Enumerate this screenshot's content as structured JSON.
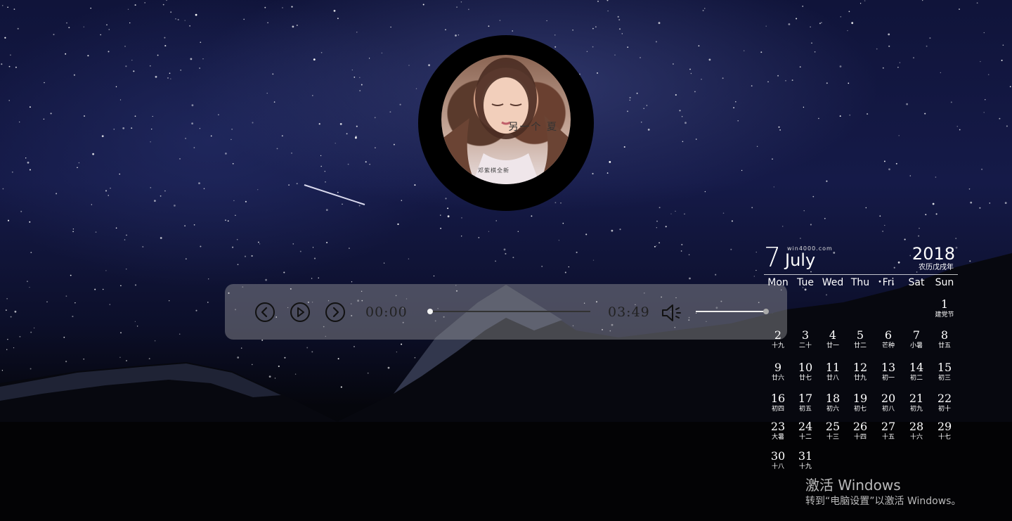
{
  "album": {
    "title_text": "另一个 夏",
    "caption_text": "邓紫棋全新"
  },
  "player": {
    "current_time": "00:00",
    "total_time": "03:49",
    "progress": 0,
    "volume": 1.0,
    "icons": {
      "prev": "chevron-left-circle-icon",
      "play": "play-circle-icon",
      "next": "chevron-right-circle-icon",
      "volume": "speaker-icon"
    }
  },
  "calendar": {
    "day": "7",
    "month": "July",
    "site": "win4000.com",
    "year": "2018",
    "lunar_year": "农历戊戌年",
    "weekdays": [
      "Mon",
      "Tue",
      "Wed",
      "Thu",
      "Fri",
      "Sat",
      "Sun"
    ],
    "days": [
      {
        "n": "1",
        "l": "建党节"
      },
      {
        "n": "2",
        "l": "十九"
      },
      {
        "n": "3",
        "l": "二十"
      },
      {
        "n": "4",
        "l": "廿一"
      },
      {
        "n": "5",
        "l": "廿二"
      },
      {
        "n": "6",
        "l": "芒种"
      },
      {
        "n": "7",
        "l": "小暑"
      },
      {
        "n": "8",
        "l": "廿五"
      },
      {
        "n": "9",
        "l": "廿六"
      },
      {
        "n": "10",
        "l": "廿七"
      },
      {
        "n": "11",
        "l": "廿八"
      },
      {
        "n": "12",
        "l": "廿九"
      },
      {
        "n": "13",
        "l": "初一"
      },
      {
        "n": "14",
        "l": "初二"
      },
      {
        "n": "15",
        "l": "初三"
      },
      {
        "n": "16",
        "l": "初四"
      },
      {
        "n": "17",
        "l": "初五"
      },
      {
        "n": "18",
        "l": "初六"
      },
      {
        "n": "19",
        "l": "初七"
      },
      {
        "n": "20",
        "l": "初八"
      },
      {
        "n": "21",
        "l": "初九"
      },
      {
        "n": "22",
        "l": "初十"
      },
      {
        "n": "23",
        "l": "大暑"
      },
      {
        "n": "24",
        "l": "十二"
      },
      {
        "n": "25",
        "l": "十三"
      },
      {
        "n": "26",
        "l": "十四"
      },
      {
        "n": "27",
        "l": "十五"
      },
      {
        "n": "28",
        "l": "十六"
      },
      {
        "n": "29",
        "l": "十七"
      },
      {
        "n": "30",
        "l": "十八"
      },
      {
        "n": "31",
        "l": "十九"
      }
    ]
  },
  "watermark": {
    "title": "激活 Windows",
    "subtitle": "转到“电脑设置”以激活 Windows。"
  },
  "colors": {
    "sky_top": "#10143a",
    "ground": "#020204",
    "player_bg": "#96969b"
  }
}
